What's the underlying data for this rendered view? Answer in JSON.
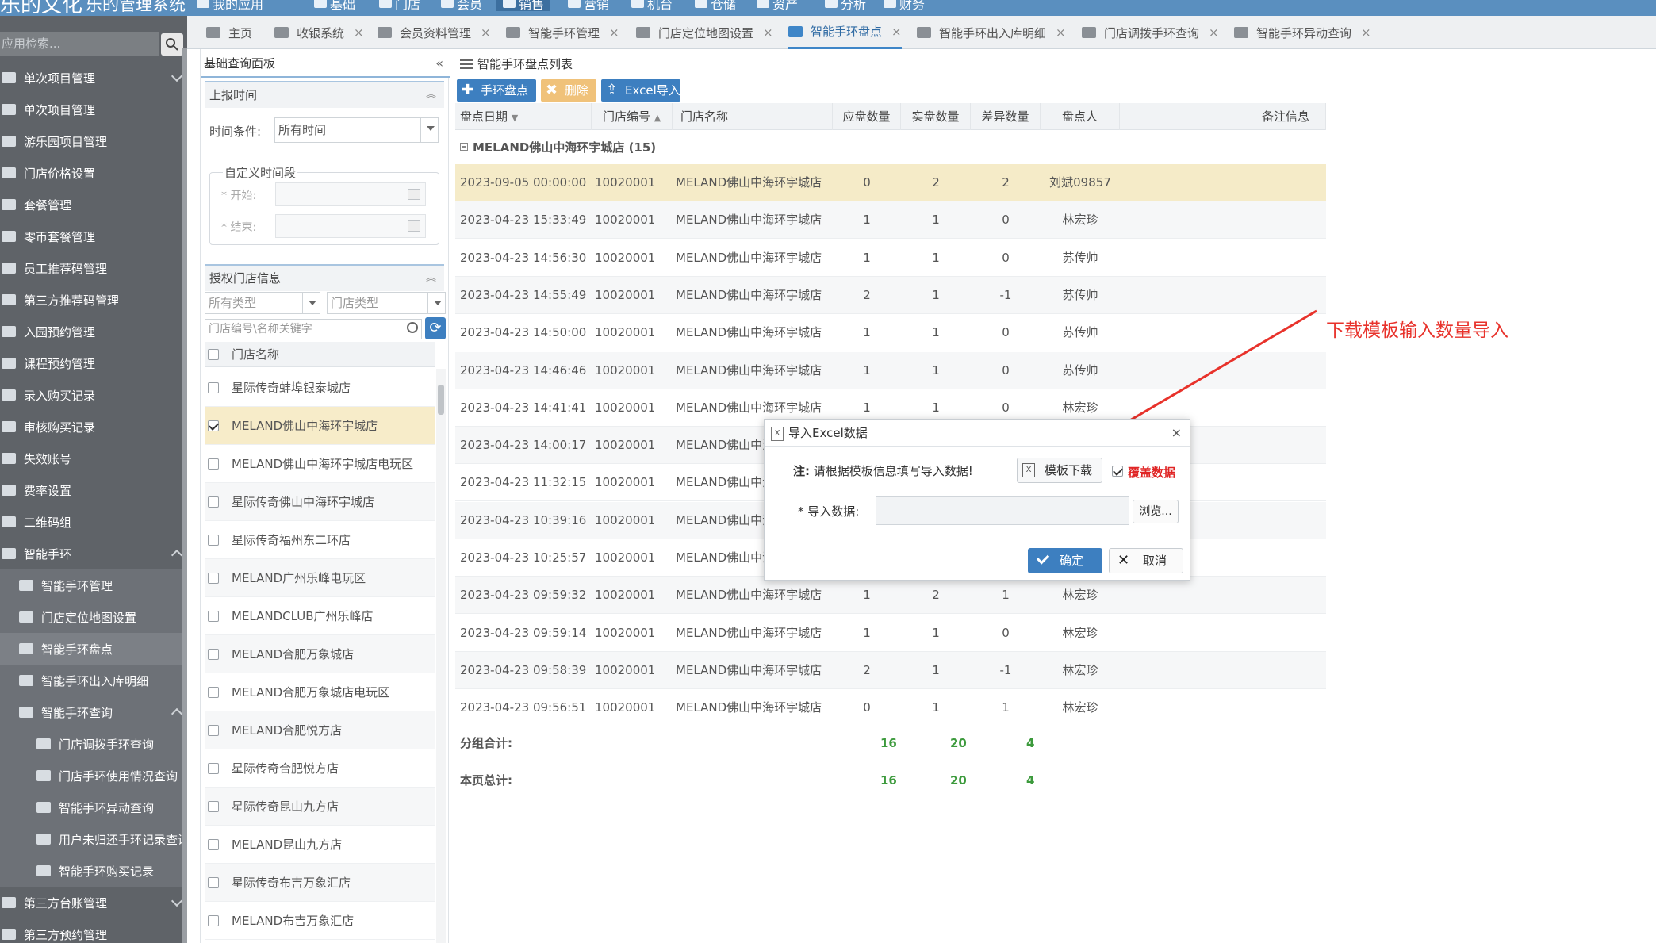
{
  "app": {
    "logo": "乐的文化",
    "subtitle": "乐的管理系统"
  },
  "topnav": [
    "我的应用",
    "基础",
    "门店",
    "会员",
    "销售",
    "营销",
    "机台",
    "仓储",
    "资产",
    "分析",
    "财务"
  ],
  "sidebar": {
    "search_placeholder": "应用检索...",
    "items": [
      {
        "label": "单次项目管理"
      },
      {
        "label": "单次项目管理"
      },
      {
        "label": "游乐园项目管理"
      },
      {
        "label": "门店价格设置"
      },
      {
        "label": "套餐管理"
      },
      {
        "label": "零币套餐管理"
      },
      {
        "label": "员工推荐码管理"
      },
      {
        "label": "第三方推荐码管理"
      },
      {
        "label": "入园预约管理"
      },
      {
        "label": "课程预约管理"
      },
      {
        "label": "录入购买记录"
      },
      {
        "label": "审核购买记录"
      },
      {
        "label": "失效账号"
      },
      {
        "label": "费率设置"
      },
      {
        "label": "二维码组"
      },
      {
        "label": "智能手环"
      },
      {
        "label": "智能手环管理"
      },
      {
        "label": "门店定位地图设置"
      },
      {
        "label": "智能手环盘点"
      },
      {
        "label": "智能手环出入库明细"
      },
      {
        "label": "智能手环查询"
      },
      {
        "label": "门店调拨手环查询"
      },
      {
        "label": "门店手环使用情况查询"
      },
      {
        "label": "智能手环异动查询"
      },
      {
        "label": "用户未归还手环记录查询"
      },
      {
        "label": "智能手环购买记录"
      },
      {
        "label": "第三方台账管理"
      },
      {
        "label": "第三方预约管理"
      }
    ]
  },
  "tabs": [
    {
      "label": "主页"
    },
    {
      "label": "收银系统"
    },
    {
      "label": "会员资料管理"
    },
    {
      "label": "智能手环管理"
    },
    {
      "label": "门店定位地图设置"
    },
    {
      "label": "智能手环盘点"
    },
    {
      "label": "智能手环出入库明细"
    },
    {
      "label": "门店调拨手环查询"
    },
    {
      "label": "智能手环异动查询"
    }
  ],
  "filter_panel": {
    "title": "基础查询面板",
    "report_time": "上报时间",
    "time_condition_label": "时间条件:",
    "time_condition_value": "所有时间",
    "custom_range": "自定义时间段",
    "start_label": "* 开始:",
    "end_label": "* 结束:",
    "auth_store": "授权门店信息",
    "type_all": "所有类型",
    "store_type": "门店类型",
    "search_placeholder": "门店编号\\名称关键字",
    "store_name_header": "门店名称",
    "stores": [
      {
        "name": "星际传奇蚌埠银泰城店",
        "checked": false
      },
      {
        "name": "MELAND佛山中海环宇城店",
        "checked": true
      },
      {
        "name": "MELAND佛山中海环宇城店电玩区",
        "checked": false
      },
      {
        "name": "星际传奇佛山中海环宇城店",
        "checked": false
      },
      {
        "name": "星际传奇福州东二环店",
        "checked": false
      },
      {
        "name": "MELAND广州乐峰电玩区",
        "checked": false
      },
      {
        "name": "MELANDCLUB广州乐峰店",
        "checked": false
      },
      {
        "name": "MELAND合肥万象城店",
        "checked": false
      },
      {
        "name": "MELAND合肥万象城店电玩区",
        "checked": false
      },
      {
        "name": "MELAND合肥悦方店",
        "checked": false
      },
      {
        "name": "星际传奇合肥悦方店",
        "checked": false
      },
      {
        "name": "星际传奇昆山九方店",
        "checked": false
      },
      {
        "name": "MELAND昆山九方店",
        "checked": false
      },
      {
        "name": "星际传奇布吉万象汇店",
        "checked": false
      },
      {
        "name": "MELAND布吉万象汇店",
        "checked": false
      }
    ]
  },
  "main": {
    "title": "智能手环盘点列表",
    "btn_add": "手环盘点",
    "btn_delete": "删除",
    "btn_import": "Excel导入",
    "columns": [
      "盘点日期",
      "门店编号",
      "门店名称",
      "应盘数量",
      "实盘数量",
      "差异数量",
      "盘点人",
      "备注信息"
    ],
    "group_label": "MELAND佛山中海环宇城店 (15)",
    "rows": [
      {
        "date": "2023-09-05 00:00:00",
        "code": "10020001",
        "store": "MELAND佛山中海环宇城店",
        "expected": "0",
        "actual": "2",
        "diff": "2",
        "person": "刘斌09857"
      },
      {
        "date": "2023-04-23 15:33:49",
        "code": "10020001",
        "store": "MELAND佛山中海环宇城店",
        "expected": "1",
        "actual": "1",
        "diff": "0",
        "person": "林宏珍"
      },
      {
        "date": "2023-04-23 14:56:30",
        "code": "10020001",
        "store": "MELAND佛山中海环宇城店",
        "expected": "1",
        "actual": "1",
        "diff": "0",
        "person": "苏传帅"
      },
      {
        "date": "2023-04-23 14:55:49",
        "code": "10020001",
        "store": "MELAND佛山中海环宇城店",
        "expected": "2",
        "actual": "1",
        "diff": "-1",
        "person": "苏传帅"
      },
      {
        "date": "2023-04-23 14:50:00",
        "code": "10020001",
        "store": "MELAND佛山中海环宇城店",
        "expected": "1",
        "actual": "1",
        "diff": "0",
        "person": "苏传帅"
      },
      {
        "date": "2023-04-23 14:46:46",
        "code": "10020001",
        "store": "MELAND佛山中海环宇城店",
        "expected": "1",
        "actual": "1",
        "diff": "0",
        "person": "苏传帅"
      },
      {
        "date": "2023-04-23 14:41:41",
        "code": "10020001",
        "store": "MELAND佛山中海环宇城店",
        "expected": "1",
        "actual": "1",
        "diff": "0",
        "person": "林宏珍"
      },
      {
        "date": "2023-04-23 14:00:17",
        "code": "10020001",
        "store": "MELAND佛山中海",
        "expected": "",
        "actual": "",
        "diff": "",
        "person": ""
      },
      {
        "date": "2023-04-23 11:32:15",
        "code": "10020001",
        "store": "MELAND佛山中海",
        "expected": "",
        "actual": "",
        "diff": "",
        "person": ""
      },
      {
        "date": "2023-04-23 10:39:16",
        "code": "10020001",
        "store": "MELAND佛山中海",
        "expected": "",
        "actual": "",
        "diff": "",
        "person": ""
      },
      {
        "date": "2023-04-23 10:25:57",
        "code": "10020001",
        "store": "MELAND佛山中海",
        "expected": "",
        "actual": "",
        "diff": "",
        "person": ""
      },
      {
        "date": "2023-04-23 09:59:32",
        "code": "10020001",
        "store": "MELAND佛山中海环宇城店",
        "expected": "1",
        "actual": "2",
        "diff": "1",
        "person": "林宏珍"
      },
      {
        "date": "2023-04-23 09:59:14",
        "code": "10020001",
        "store": "MELAND佛山中海环宇城店",
        "expected": "1",
        "actual": "1",
        "diff": "0",
        "person": "林宏珍"
      },
      {
        "date": "2023-04-23 09:58:39",
        "code": "10020001",
        "store": "MELAND佛山中海环宇城店",
        "expected": "2",
        "actual": "1",
        "diff": "-1",
        "person": "林宏珍"
      },
      {
        "date": "2023-04-23 09:56:51",
        "code": "10020001",
        "store": "MELAND佛山中海环宇城店",
        "expected": "0",
        "actual": "1",
        "diff": "1",
        "person": "林宏珍"
      }
    ],
    "group_total": {
      "label": "分组合计:",
      "expected": "16",
      "actual": "20",
      "diff": "4"
    },
    "page_total": {
      "label": "本页总计:",
      "expected": "16",
      "actual": "20",
      "diff": "4"
    }
  },
  "annotation": "下载模板输入数量导入",
  "modal": {
    "title": "导入Excel数据",
    "note_prefix": "注:",
    "note_text": "请根据模板信息填写导入数据!",
    "download_btn": "模板下载",
    "cover_label": "覆盖数据",
    "import_label": "* 导入数据:",
    "browse_btn": "浏览...",
    "ok_btn": "确定",
    "cancel_btn": "取消"
  },
  "colors": {
    "accent": "#3d7fc0",
    "highlight_row": "#f5ebc8",
    "annotation": "#e8322b",
    "total_green": "#3c9a3c"
  }
}
